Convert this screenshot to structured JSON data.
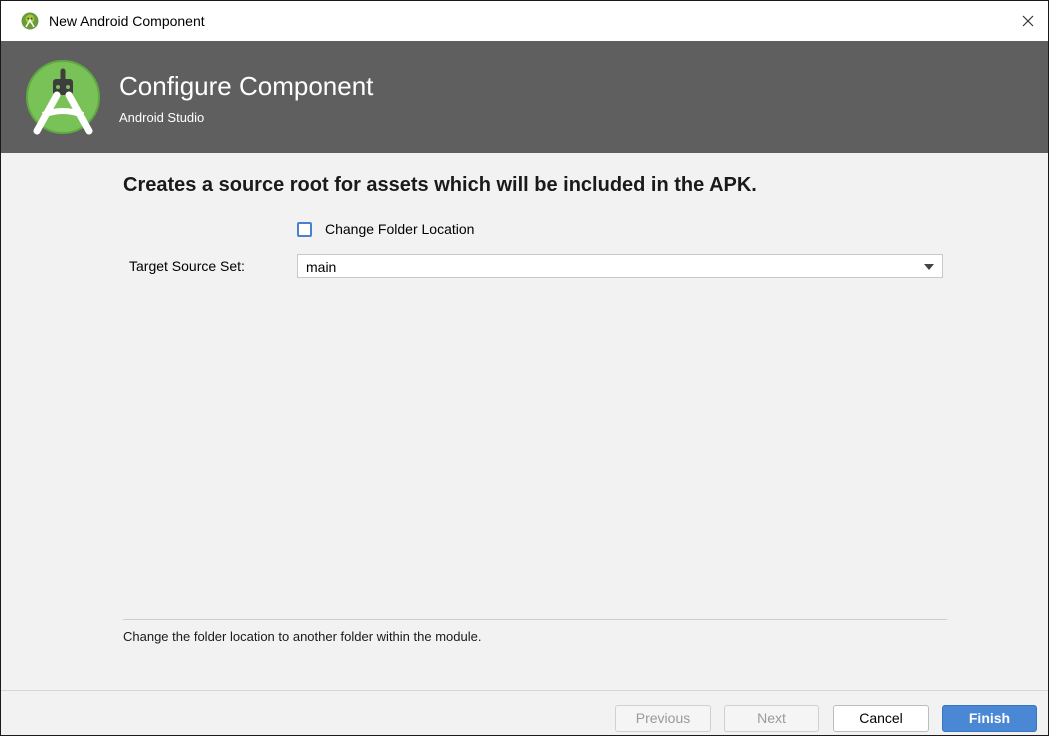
{
  "window": {
    "title": "New Android Component",
    "app_icon": "android-studio-icon",
    "close_icon": "close-icon"
  },
  "header": {
    "title": "Configure Component",
    "subtitle": "Android Studio",
    "logo": "android-studio-logo",
    "background_color": "#5f5f5f"
  },
  "content": {
    "headline": "Creates a source root for assets which will be included in the APK.",
    "change_folder": {
      "label": "Change Folder Location",
      "checked": false
    },
    "target_source_set": {
      "label": "Target Source Set:",
      "value": "main"
    },
    "help_text": "Change the folder location to another folder within the module."
  },
  "footer": {
    "previous_label": "Previous",
    "next_label": "Next",
    "cancel_label": "Cancel",
    "finish_label": "Finish",
    "primary_color": "#4a87d4"
  }
}
